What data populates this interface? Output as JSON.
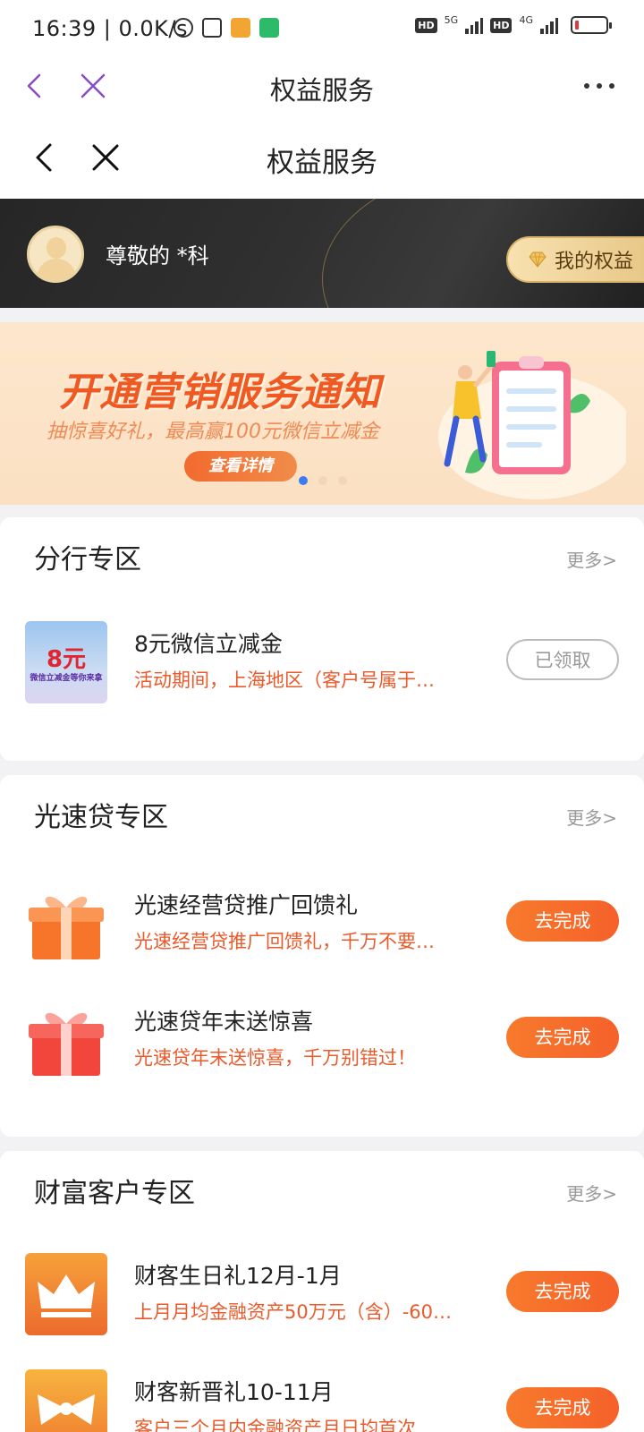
{
  "status_bar": {
    "time": "16:39 | 0.0K/s",
    "network_1": "5G",
    "network_2": "4G",
    "hd_1": "HD",
    "hd_2": "HD"
  },
  "outer_nav": {
    "title": "权益服务"
  },
  "inner_nav": {
    "title": "权益服务"
  },
  "member": {
    "greeting": "尊敬的 *科",
    "rights_button": "我的权益"
  },
  "banner": {
    "headline": "开通营销服务通知",
    "subline": "抽惊喜好礼，最高赢100元微信立减金",
    "cta": "查看详情",
    "active_slide": 1,
    "slide_count": 3
  },
  "sections": [
    {
      "title": "分行专区",
      "more": "更多>",
      "items": [
        {
          "title": "8元微信立减金",
          "desc": "活动期间，上海地区（客户号属于…",
          "button": "已领取",
          "thumb_text": "8元",
          "thumb_subtext": "微信立减金等你来拿"
        }
      ]
    },
    {
      "title": "光速贷专区",
      "more": "更多>",
      "items": [
        {
          "title": "光速经营贷推广回馈礼",
          "desc": "光速经营贷推广回馈礼，千万不要…",
          "button": "去完成"
        },
        {
          "title": "光速贷年末送惊喜",
          "desc": "光速贷年末送惊喜，千万别错过！",
          "button": "去完成"
        }
      ]
    },
    {
      "title": "财富客户专区",
      "more": "更多>",
      "items": [
        {
          "title": "财客生日礼12月-1月",
          "desc": "上月月均金融资产50万元（含）-60…",
          "button": "去完成"
        },
        {
          "title": "财客新晋礼10-11月",
          "desc": "客户三个月内金融资产月日均首次…",
          "button": "去完成"
        }
      ]
    }
  ],
  "colors": {
    "accent_orange": "#f5612a",
    "nav_purple": "#8a4cc0",
    "desc_orange": "#ea5a2a"
  }
}
